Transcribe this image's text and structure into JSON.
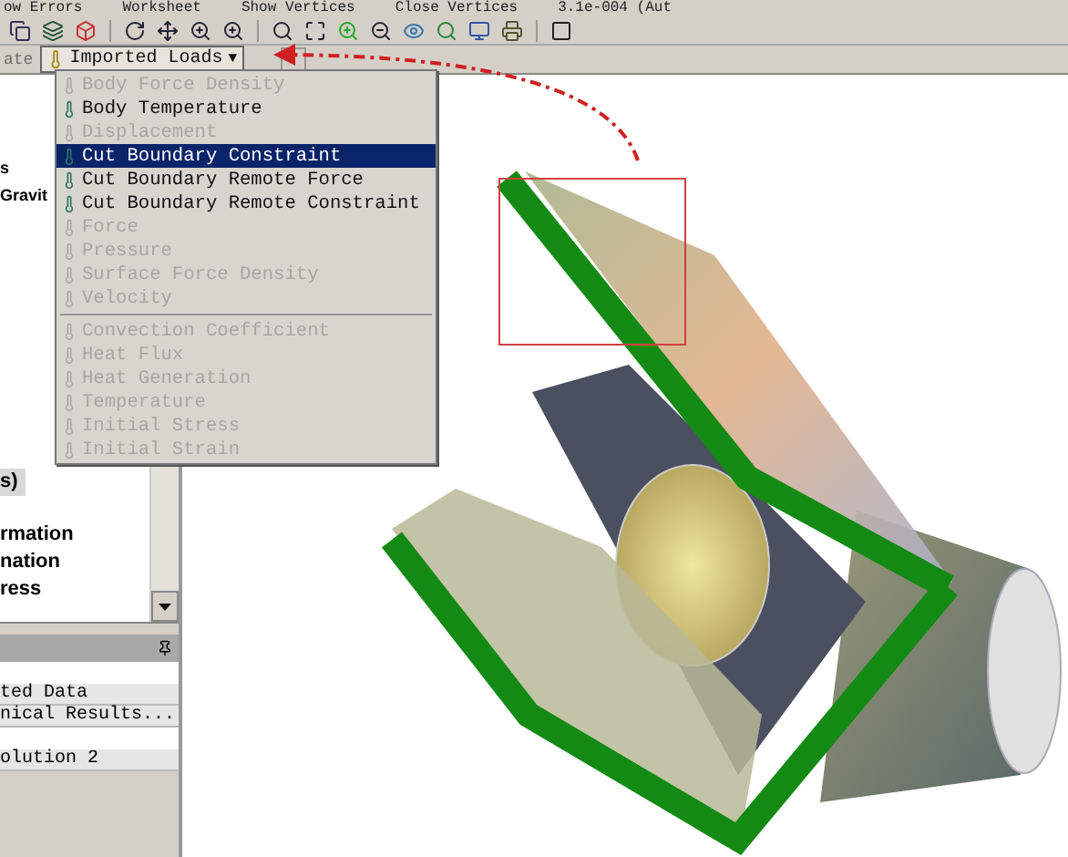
{
  "top_toolbar": {
    "items": [
      "ow Errors",
      "Worksheet",
      "Show Vertices",
      "Close Vertices",
      "3.1e-004 (Aut"
    ]
  },
  "tab_strip": {
    "left_tab": "ate",
    "dropdown": {
      "label": "Imported Loads",
      "caret": "▼",
      "expanded": true
    }
  },
  "menu": {
    "sections": [
      [
        {
          "label": "Body Force Density",
          "disabled": true,
          "selected": false
        },
        {
          "label": "Body Temperature",
          "disabled": false,
          "selected": false
        },
        {
          "label": "Displacement",
          "disabled": true,
          "selected": false
        },
        {
          "label": "Cut Boundary Constraint",
          "disabled": false,
          "selected": true
        },
        {
          "label": "Cut Boundary Remote Force",
          "disabled": false,
          "selected": false
        },
        {
          "label": "Cut Boundary Remote Constraint",
          "disabled": false,
          "selected": false
        },
        {
          "label": "Force",
          "disabled": true,
          "selected": false
        },
        {
          "label": "Pressure",
          "disabled": true,
          "selected": false
        },
        {
          "label": "Surface Force Density",
          "disabled": true,
          "selected": false
        },
        {
          "label": "Velocity",
          "disabled": true,
          "selected": false
        }
      ],
      [
        {
          "label": "Convection Coefficient",
          "disabled": true,
          "selected": false
        },
        {
          "label": "Heat Flux",
          "disabled": true,
          "selected": false
        },
        {
          "label": "Heat Generation",
          "disabled": true,
          "selected": false
        },
        {
          "label": "Temperature",
          "disabled": true,
          "selected": false
        },
        {
          "label": "Initial Stress",
          "disabled": true,
          "selected": false
        },
        {
          "label": "Initial Strain",
          "disabled": true,
          "selected": false
        }
      ]
    ]
  },
  "tree": {
    "upper": [
      {
        "label": "s",
        "selected": false
      },
      {
        "label": "Gravit",
        "selected": false
      }
    ],
    "lower": [
      {
        "label": "s)",
        "selected": true
      },
      {
        "label": "rmation",
        "selected": false
      },
      {
        "label": "nation",
        "selected": false
      },
      {
        "label": "ress",
        "selected": false
      }
    ]
  },
  "details": {
    "rows": [
      {
        "label": "ted Data"
      },
      {
        "label": "nical Results..."
      },
      {
        "label": "olution 2"
      }
    ]
  }
}
